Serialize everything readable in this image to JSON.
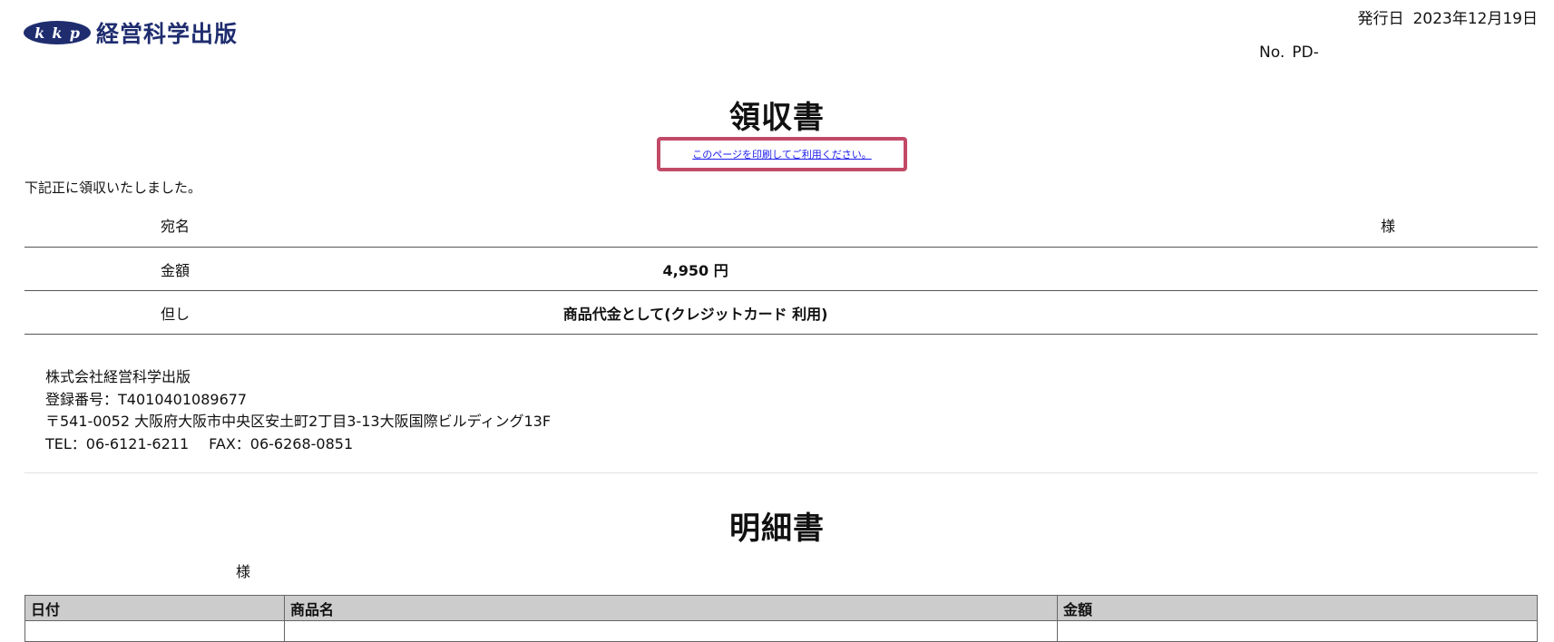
{
  "logo": {
    "letters": [
      "k",
      "k",
      "p"
    ],
    "name": "経営科学出版",
    "color": "#1f2d6f"
  },
  "issue": {
    "label": "発行日",
    "date": "2023年12月19日"
  },
  "document_number": {
    "label": "No.",
    "value": "PD-"
  },
  "receipt": {
    "title": "領収書",
    "print_link": "このページを印刷してご利用ください。",
    "intro": "下記正に領収いたしました。",
    "rows": [
      {
        "label": "宛名",
        "value": "",
        "suffix": "様"
      },
      {
        "label": "金額",
        "value": "4,950 円",
        "suffix": ""
      },
      {
        "label": "但し",
        "value": "商品代金として(クレジットカード 利用)",
        "suffix": ""
      }
    ]
  },
  "company": {
    "name": "株式会社経営科学出版",
    "registration": "登録番号：T4010401089677",
    "address": "〒541-0052 大阪府大阪市中央区安土町2丁目3-13大阪国際ビルディング13F",
    "tel": "TEL：06-6121-6211",
    "fax": "FAX：06-6268-0851"
  },
  "statement": {
    "title": "明細書",
    "honorific": "様",
    "columns": [
      "日付",
      "商品名",
      "金額"
    ]
  },
  "colors": {
    "highlight_border": "#c24a68",
    "link": "#1a1aee",
    "table_header_bg": "#cccccc"
  }
}
